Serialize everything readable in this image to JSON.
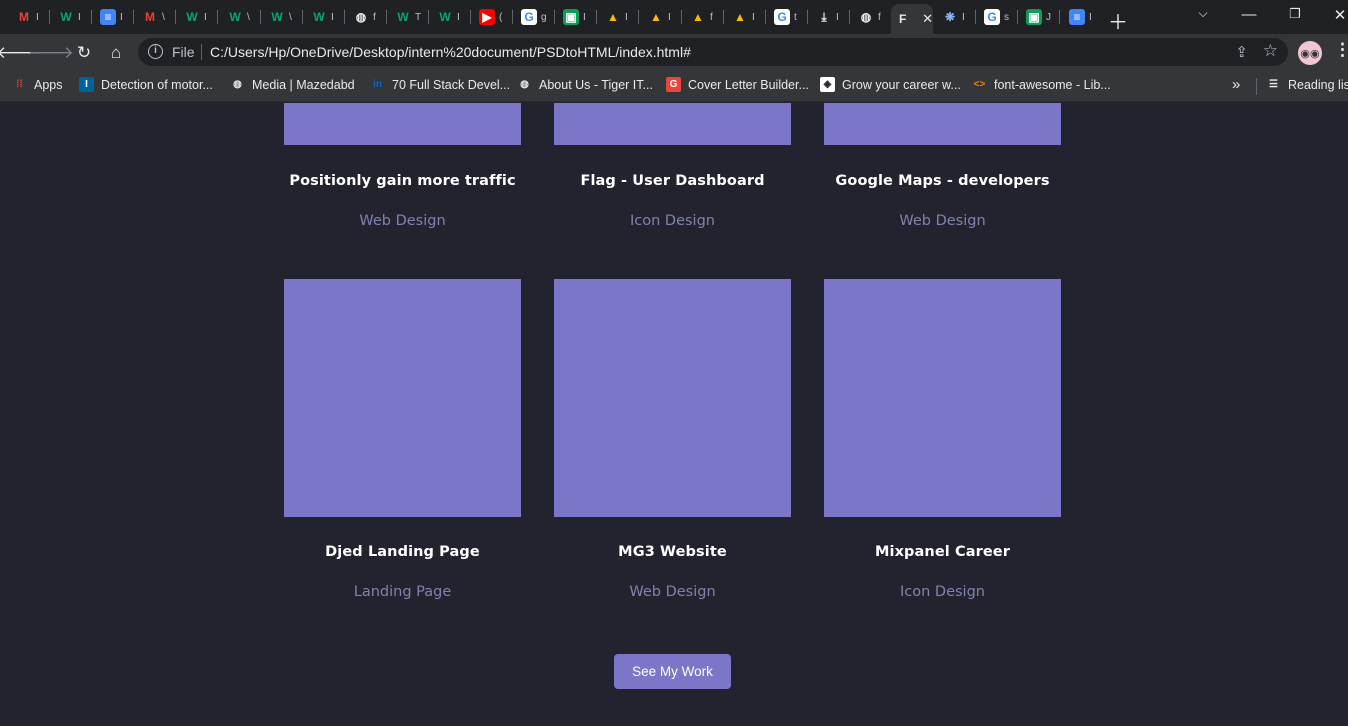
{
  "browser": {
    "tabs": [
      {
        "icon": "gmail-icon",
        "glyph": "M",
        "color": "#ea4335",
        "bg": "transparent",
        "title": "I"
      },
      {
        "icon": "w-icon",
        "glyph": "W",
        "color": "#00a86b",
        "bg": "transparent",
        "title": "I"
      },
      {
        "icon": "docs-icon",
        "glyph": "≡",
        "color": "#ffffff",
        "bg": "#4285f4",
        "title": "I"
      },
      {
        "icon": "gmail-icon",
        "glyph": "M",
        "color": "#ea4335",
        "bg": "transparent",
        "title": "\\"
      },
      {
        "icon": "w-icon",
        "glyph": "W",
        "color": "#00a86b",
        "bg": "transparent",
        "title": "I"
      },
      {
        "icon": "w-icon",
        "glyph": "W",
        "color": "#00a86b",
        "bg": "transparent",
        "title": "\\"
      },
      {
        "icon": "w-icon",
        "glyph": "W",
        "color": "#00a86b",
        "bg": "transparent",
        "title": "\\"
      },
      {
        "icon": "w-icon",
        "glyph": "W",
        "color": "#00a86b",
        "bg": "transparent",
        "title": "I"
      },
      {
        "icon": "globe-icon",
        "glyph": "◍",
        "color": "#e8eaed",
        "bg": "transparent",
        "title": "f"
      },
      {
        "icon": "w-icon",
        "glyph": "W",
        "color": "#00a86b",
        "bg": "transparent",
        "title": "T"
      },
      {
        "icon": "w-icon",
        "glyph": "W",
        "color": "#00a86b",
        "bg": "transparent",
        "title": "I"
      },
      {
        "icon": "youtube-icon",
        "glyph": "▶",
        "color": "#ffffff",
        "bg": "#ff0000",
        "title": "("
      },
      {
        "icon": "google-icon",
        "glyph": "G",
        "color": "#4285f4",
        "bg": "#ffffff",
        "title": "g"
      },
      {
        "icon": "classroom-icon",
        "glyph": "▣",
        "color": "#ffffff",
        "bg": "#0f9d58",
        "title": "I"
      },
      {
        "icon": "drive-icon",
        "glyph": "▲",
        "color": "#fbbc04",
        "bg": "transparent",
        "title": "I"
      },
      {
        "icon": "drive-icon",
        "glyph": "▲",
        "color": "#fbbc04",
        "bg": "transparent",
        "title": "I"
      },
      {
        "icon": "drive-icon",
        "glyph": "▲",
        "color": "#fbbc04",
        "bg": "transparent",
        "title": "f"
      },
      {
        "icon": "drive-icon",
        "glyph": "▲",
        "color": "#fbbc04",
        "bg": "transparent",
        "title": "I"
      },
      {
        "icon": "google-icon",
        "glyph": "G",
        "color": "#4285f4",
        "bg": "#ffffff",
        "title": "t"
      },
      {
        "icon": "download-icon",
        "glyph": "⤓",
        "color": "#e8eaed",
        "bg": "transparent",
        "title": "I"
      },
      {
        "icon": "globe-icon",
        "glyph": "◍",
        "color": "#e8eaed",
        "bg": "transparent",
        "title": "f"
      },
      {
        "icon": "page-icon",
        "glyph": "F",
        "color": "#e8eaed",
        "bg": "transparent",
        "title": "",
        "active": true
      },
      {
        "icon": "brain-icon",
        "glyph": "❋",
        "color": "#8ab4f8",
        "bg": "transparent",
        "title": "I"
      },
      {
        "icon": "google-icon",
        "glyph": "G",
        "color": "#4285f4",
        "bg": "#ffffff",
        "title": "s"
      },
      {
        "icon": "classroom-icon",
        "glyph": "▣",
        "color": "#ffffff",
        "bg": "#0f9d58",
        "title": "J"
      },
      {
        "icon": "docs-icon",
        "glyph": "≡",
        "color": "#ffffff",
        "bg": "#4285f4",
        "title": "I"
      }
    ],
    "address": {
      "file_label": "File",
      "url": "C:/Users/Hp/OneDrive/Desktop/intern%20document/PSDtoHTML/index.html#"
    },
    "bookmarks": [
      {
        "icon": "apps-icon",
        "glyph": "⁞⁞",
        "color": "#ea4335",
        "bg": "transparent",
        "label": "Apps"
      },
      {
        "icon": "ieee-icon",
        "glyph": "I",
        "color": "#ffffff",
        "bg": "#00629b",
        "label": "Detection of motor..."
      },
      {
        "icon": "globe-icon",
        "glyph": "◍",
        "color": "#e8eaed",
        "bg": "transparent",
        "label": "Media | Mazedabd"
      },
      {
        "icon": "linkedin-icon",
        "glyph": "in",
        "color": "#0a66c2",
        "bg": "transparent",
        "label": "70 Full Stack Devel..."
      },
      {
        "icon": "globe-icon",
        "glyph": "◍",
        "color": "#e8eaed",
        "bg": "transparent",
        "label": "About Us - Tiger IT..."
      },
      {
        "icon": "g-icon",
        "glyph": "G",
        "color": "#ffffff",
        "bg": "#e8453c",
        "label": "Cover Letter Builder..."
      },
      {
        "icon": "badge-icon",
        "glyph": "◈",
        "color": "#222222",
        "bg": "#ffffff",
        "label": "Grow your career w..."
      },
      {
        "icon": "code-icon",
        "glyph": "<>",
        "color": "#ea8600",
        "bg": "transparent",
        "label": "font-awesome - Lib..."
      },
      {
        "icon": "reading-list-icon",
        "glyph": "☰",
        "color": "#e8eaed",
        "bg": "transparent",
        "label": "Reading list"
      }
    ]
  },
  "page": {
    "top_row": [
      {
        "title": "Positionly gain more traffic",
        "category": "Web Design"
      },
      {
        "title": "Flag - User Dashboard",
        "category": "Icon Design"
      },
      {
        "title": "Google Maps - developers",
        "category": "Web Design"
      }
    ],
    "bottom_row": [
      {
        "title": "Djed Landing Page",
        "category": "Landing Page"
      },
      {
        "title": "MG3 Website",
        "category": "Web Design"
      },
      {
        "title": "Mixpanel Career",
        "category": "Icon Design"
      }
    ],
    "cta_label": "See My Work",
    "colors": {
      "background": "#23222f",
      "accent": "#7b76c8",
      "muted_text": "#7f83ad"
    }
  }
}
